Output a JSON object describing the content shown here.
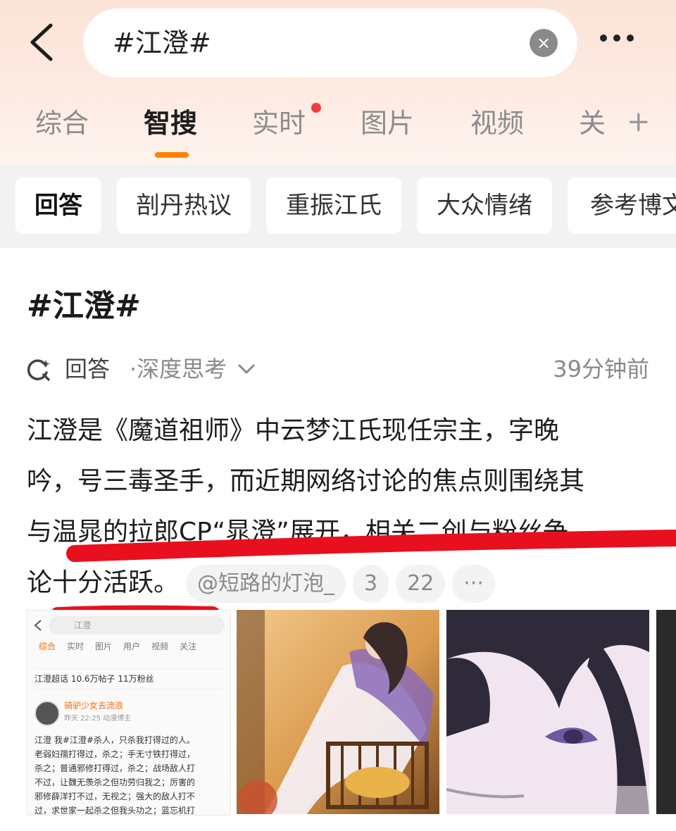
{
  "header": {
    "search_query": "#江澄#",
    "clear_label": "×"
  },
  "tabs": [
    {
      "label": "综合"
    },
    {
      "label": "智搜"
    },
    {
      "label": "实时"
    },
    {
      "label": "图片"
    },
    {
      "label": "视频"
    },
    {
      "label": "关"
    }
  ],
  "tabs_add_label": "+",
  "chips": [
    {
      "label": "回答"
    },
    {
      "label": "剖丹热议"
    },
    {
      "label": "重振江氏"
    },
    {
      "label": "大众情绪"
    },
    {
      "label": "参考博文"
    }
  ],
  "answer": {
    "heading": "#江澄#",
    "label": "回答",
    "mode": "·深度思考",
    "time": "39分钟前",
    "lines": [
      "江澄是《魔道祖师》中云梦江氏现任宗主，字晚",
      "吟，号三毒圣手，而近期网络讨论的焦点则围绕其",
      "与温晁的拉郎CP“晁澄”展开，相关二创与粉丝争",
      "论十分活跃。"
    ],
    "source": "@短路的灯泡_",
    "ref_a": "3",
    "ref_b": "22",
    "ref_more": "···"
  },
  "mini_screenshot": {
    "search": "江澄",
    "tabs": [
      "综合",
      "实时",
      "图片",
      "用户",
      "视频",
      "关注"
    ],
    "super_topic": "江澄超话 10.6万帖子 11万粉丝",
    "user_name": "骑驴少女去流浪",
    "user_meta": "昨天 22:25 动漫博主",
    "text_lines": [
      "江澄 我#江澄#杀人，只杀我打得过的人。",
      "老弱妇孺打得过，杀之；手无寸铁打得过，",
      "杀之；普通邪修打得过，杀之；战场敌人打",
      "不过，让魏无羡杀之但功劳归我之；厉害的",
      "邪修薛洋打不过，无视之；强大的敌人打不",
      "过，求世家一起杀之但我头功之；蓝忘机打"
    ]
  },
  "colors": {
    "accent": "#ff8200",
    "highlight": "#e8101e"
  }
}
